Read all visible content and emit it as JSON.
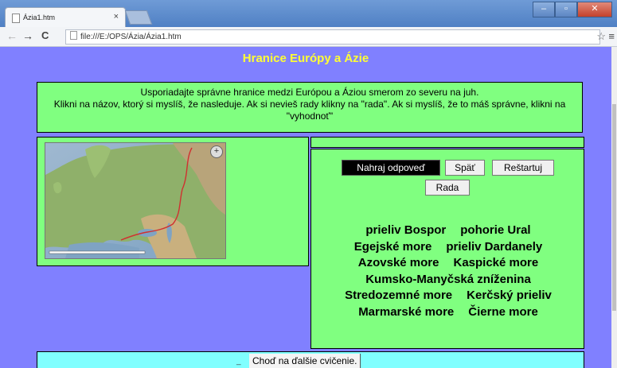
{
  "browser": {
    "tab_title": "Ázia1.htm",
    "tab_close": "×",
    "url": "file:///E:/OPS/Ázia/Ázia1.htm",
    "back": "←",
    "forward": "→",
    "reload": "C",
    "star": "☆",
    "menu": "≡",
    "minimize": "–",
    "maximize": "▫",
    "close": "✕"
  },
  "page": {
    "title": "Hranice Európy a Ázie",
    "instructions": [
      "Usporiadajte správne hranice medzi Európou a Áziou smerom zo severu na juh.",
      "Klikni na názov, ktorý si myslíš, že nasleduje. Ak si nevieš rady klikny na \"rada\". Ak si myslíš, že to máš správne, klikni na \"vyhodnoť\""
    ],
    "buttons": {
      "load_answer": "Nahraj odpoveď",
      "back": "Späť",
      "restart": "Reštartuj",
      "hint": "Rada"
    },
    "options": [
      [
        "prieliv Bospor",
        "pohorie Ural"
      ],
      [
        "Egejské more",
        "prieliv Dardanely"
      ],
      [
        "Azovské more",
        "Kaspické more"
      ],
      [
        "Kumsko-Manyčská zníženina"
      ],
      [
        "Stredozemné more",
        "Kerčský prieliv"
      ],
      [
        "Marmarské more",
        "Čierne more"
      ]
    ],
    "next_exercise": "Choď na ďalšie cvičenie."
  },
  "colors": {
    "page_bg": "#8080ff",
    "panel_green": "#80ff80",
    "bottom_cyan": "#80ffff",
    "title_yellow": "#ffff33"
  },
  "icons": {
    "map_zoom": "zoom-icon"
  }
}
